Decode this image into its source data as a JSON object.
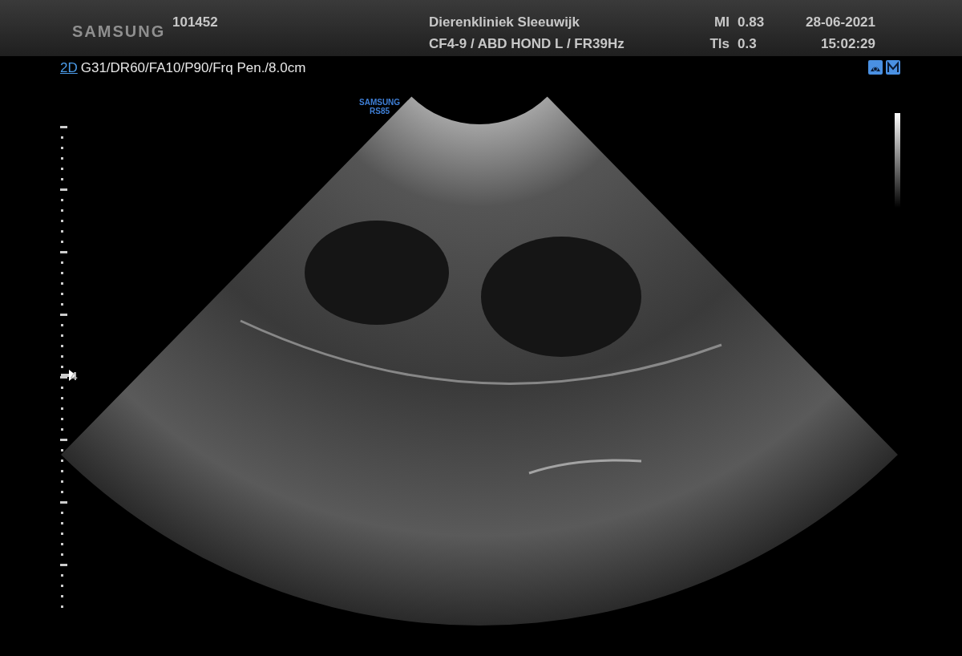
{
  "header": {
    "logo": "SAMSUNG",
    "patient_id": "101452",
    "clinic": "Dierenkliniek Sleeuwijk",
    "probe_preset": "CF4-9 / ABD HOND L / FR39Hz",
    "indices": [
      {
        "label": "MI",
        "value": "0.83"
      },
      {
        "label": "Tls",
        "value": "0.3"
      }
    ],
    "date": "28-06-2021",
    "time": "15:02:29"
  },
  "params": {
    "mode": "2D",
    "settings": "G31/DR60/FA10/P90/Frq Pen./8.0cm"
  },
  "probe_label": [
    "SAMSUNG",
    "RS85"
  ],
  "depth_marker": "4"
}
